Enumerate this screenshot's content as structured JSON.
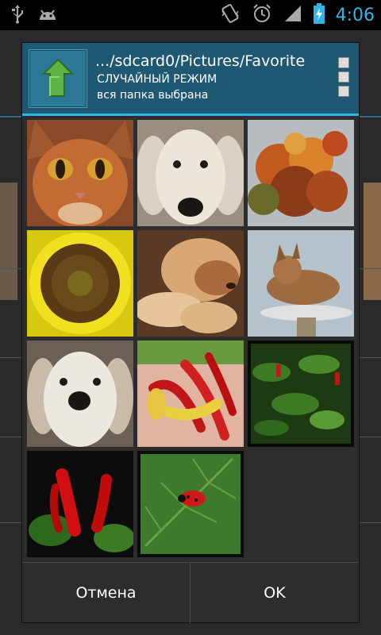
{
  "status_bar": {
    "time": "4:06",
    "icons": [
      "usb-icon",
      "android-icon",
      "vibrate-icon",
      "alarm-icon",
      "signal-icon",
      "battery-charging-icon"
    ],
    "time_color": "#33b5e5"
  },
  "dialog": {
    "path": ".../sdcard0/Pictures/Favorite",
    "mode": "СЛУЧАЙНЫЙ РЕЖИМ",
    "status": "вся папка выбрана",
    "header_color": "#1f5872",
    "accent_color": "#33b5e5",
    "images": [
      "cat-face-photo",
      "white-dog-photo",
      "autumn-leaves-photo",
      "sunflower-photo",
      "sleeping-dog-photo",
      "cat-on-post-photo",
      "dog-closeup-photo",
      "chili-peppers-hand-photo",
      "chili-plant-photo",
      "red-peppers-photo",
      "ladybug-leaf-photo"
    ],
    "cancel_label": "Отмена",
    "ok_label": "OK"
  }
}
